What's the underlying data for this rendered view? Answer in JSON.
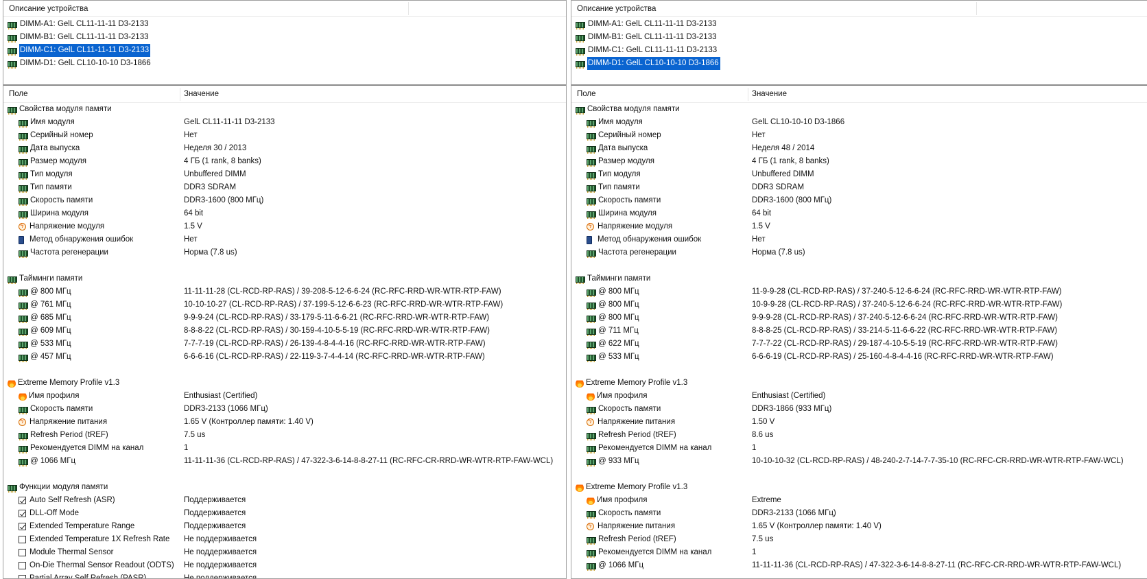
{
  "left": {
    "device_header": "Описание устройства",
    "devices": [
      {
        "label": "DIMM-A1: GelL CL11-11-11 D3-2133",
        "selected": false
      },
      {
        "label": "DIMM-B1: GelL CL11-11-11 D3-2133",
        "selected": false
      },
      {
        "label": "DIMM-C1: GelL CL11-11-11 D3-2133",
        "selected": true
      },
      {
        "label": "DIMM-D1: GelL CL10-10-10 D3-1866",
        "selected": false
      }
    ],
    "columns": {
      "field": "Поле",
      "value": "Значение"
    },
    "rows": [
      {
        "type": "section",
        "icon": "ram-icon",
        "label": "Свойства модуля памяти"
      },
      {
        "type": "item",
        "icon": "ram-icon",
        "label": "Имя модуля",
        "value": "GelL CL11-11-11 D3-2133"
      },
      {
        "type": "item",
        "icon": "ram-icon",
        "label": "Серийный номер",
        "value": "Нет"
      },
      {
        "type": "item",
        "icon": "ram-icon",
        "label": "Дата выпуска",
        "value": "Неделя 30 / 2013"
      },
      {
        "type": "item",
        "icon": "ram-icon",
        "label": "Размер модуля",
        "value": "4 ГБ (1 rank, 8 banks)"
      },
      {
        "type": "item",
        "icon": "ram-icon",
        "label": "Тип модуля",
        "value": "Unbuffered DIMM"
      },
      {
        "type": "item",
        "icon": "ram-icon",
        "label": "Тип памяти",
        "value": "DDR3 SDRAM"
      },
      {
        "type": "item",
        "icon": "ram-icon",
        "label": "Скорость памяти",
        "value": "DDR3-1600 (800 МГц)"
      },
      {
        "type": "item",
        "icon": "ram-icon",
        "label": "Ширина модуля",
        "value": "64 bit"
      },
      {
        "type": "item",
        "icon": "voltage-icon",
        "label": "Напряжение модуля",
        "value": "1.5 V"
      },
      {
        "type": "item",
        "icon": "error-detection-icon",
        "label": "Метод обнаружения ошибок",
        "value": "Нет"
      },
      {
        "type": "item",
        "icon": "ram-icon",
        "label": "Частота регенерации",
        "value": "Норма (7.8 us)"
      },
      {
        "type": "blank"
      },
      {
        "type": "section",
        "icon": "ram-icon",
        "label": "Тайминги памяти"
      },
      {
        "type": "item",
        "icon": "ram-icon",
        "label": "@ 800 МГц",
        "value": "11-11-11-28  (CL-RCD-RP-RAS) / 39-208-5-12-6-6-24  (RC-RFC-RRD-WR-WTR-RTP-FAW)"
      },
      {
        "type": "item",
        "icon": "ram-icon",
        "label": "@ 761 МГц",
        "value": "10-10-10-27  (CL-RCD-RP-RAS) / 37-199-5-12-6-6-23  (RC-RFC-RRD-WR-WTR-RTP-FAW)"
      },
      {
        "type": "item",
        "icon": "ram-icon",
        "label": "@ 685 МГц",
        "value": "9-9-9-24  (CL-RCD-RP-RAS) / 33-179-5-11-6-6-21  (RC-RFC-RRD-WR-WTR-RTP-FAW)"
      },
      {
        "type": "item",
        "icon": "ram-icon",
        "label": "@ 609 МГц",
        "value": "8-8-8-22  (CL-RCD-RP-RAS) / 30-159-4-10-5-5-19  (RC-RFC-RRD-WR-WTR-RTP-FAW)"
      },
      {
        "type": "item",
        "icon": "ram-icon",
        "label": "@ 533 МГц",
        "value": "7-7-7-19  (CL-RCD-RP-RAS) / 26-139-4-8-4-4-16  (RC-RFC-RRD-WR-WTR-RTP-FAW)"
      },
      {
        "type": "item",
        "icon": "ram-icon",
        "label": "@ 457 МГц",
        "value": "6-6-6-16  (CL-RCD-RP-RAS) / 22-119-3-7-4-4-14  (RC-RFC-RRD-WR-WTR-RTP-FAW)"
      },
      {
        "type": "blank"
      },
      {
        "type": "section",
        "icon": "fire-icon",
        "label": "Extreme Memory Profile v1.3"
      },
      {
        "type": "item",
        "icon": "fire-icon",
        "label": "Имя профиля",
        "value": "Enthusiast (Certified)"
      },
      {
        "type": "item",
        "icon": "ram-icon",
        "label": "Скорость памяти",
        "value": "DDR3-2133 (1066 МГц)"
      },
      {
        "type": "item",
        "icon": "voltage-icon",
        "label": "Напряжение питания",
        "value": "1.65 V  (Контроллер памяти: 1.40 V)"
      },
      {
        "type": "item",
        "icon": "ram-icon",
        "label": "Refresh Period (tREF)",
        "value": "7.5 us"
      },
      {
        "type": "item",
        "icon": "ram-icon",
        "label": "Рекомендуется DIMM на канал",
        "value": "1"
      },
      {
        "type": "item",
        "icon": "ram-icon",
        "label": "@ 1066 МГц",
        "value": "11-11-11-36  (CL-RCD-RP-RAS) / 47-322-3-6-14-8-8-27-11  (RC-RFC-CR-RRD-WR-WTR-RTP-FAW-WCL)"
      },
      {
        "type": "blank"
      },
      {
        "type": "section",
        "icon": "ram-icon",
        "label": "Функции модуля памяти"
      },
      {
        "type": "item",
        "icon": "checkbox-checked",
        "label": "Auto Self Refresh (ASR)",
        "value": "Поддерживается"
      },
      {
        "type": "item",
        "icon": "checkbox-checked",
        "label": "DLL-Off Mode",
        "value": "Поддерживается"
      },
      {
        "type": "item",
        "icon": "checkbox-checked",
        "label": "Extended Temperature Range",
        "value": "Поддерживается"
      },
      {
        "type": "item",
        "icon": "checkbox-unchecked",
        "label": "Extended Temperature 1X Refresh Rate",
        "value": "Не поддерживается"
      },
      {
        "type": "item",
        "icon": "checkbox-unchecked",
        "label": "Module Thermal Sensor",
        "value": "Не поддерживается"
      },
      {
        "type": "item",
        "icon": "checkbox-unchecked",
        "label": "On-Die Thermal Sensor Readout (ODTS)",
        "value": "Не поддерживается"
      },
      {
        "type": "item",
        "icon": "checkbox-unchecked",
        "label": "Partial Array Self Refresh (PASR)",
        "value": "Не поддерживается"
      }
    ]
  },
  "right": {
    "device_header": "Описание устройства",
    "devices": [
      {
        "label": "DIMM-A1: GelL CL11-11-11 D3-2133",
        "selected": false
      },
      {
        "label": "DIMM-B1: GelL CL11-11-11 D3-2133",
        "selected": false
      },
      {
        "label": "DIMM-C1: GelL CL11-11-11 D3-2133",
        "selected": false
      },
      {
        "label": "DIMM-D1: GelL CL10-10-10 D3-1866",
        "selected": true
      }
    ],
    "columns": {
      "field": "Поле",
      "value": "Значение"
    },
    "rows": [
      {
        "type": "section",
        "icon": "ram-icon",
        "label": "Свойства модуля памяти"
      },
      {
        "type": "item",
        "icon": "ram-icon",
        "label": "Имя модуля",
        "value": "GelL CL10-10-10 D3-1866"
      },
      {
        "type": "item",
        "icon": "ram-icon",
        "label": "Серийный номер",
        "value": "Нет"
      },
      {
        "type": "item",
        "icon": "ram-icon",
        "label": "Дата выпуска",
        "value": "Неделя 48 / 2014"
      },
      {
        "type": "item",
        "icon": "ram-icon",
        "label": "Размер модуля",
        "value": "4 ГБ (1 rank, 8 banks)"
      },
      {
        "type": "item",
        "icon": "ram-icon",
        "label": "Тип модуля",
        "value": "Unbuffered DIMM"
      },
      {
        "type": "item",
        "icon": "ram-icon",
        "label": "Тип памяти",
        "value": "DDR3 SDRAM"
      },
      {
        "type": "item",
        "icon": "ram-icon",
        "label": "Скорость памяти",
        "value": "DDR3-1600 (800 МГц)"
      },
      {
        "type": "item",
        "icon": "ram-icon",
        "label": "Ширина модуля",
        "value": "64 bit"
      },
      {
        "type": "item",
        "icon": "voltage-icon",
        "label": "Напряжение модуля",
        "value": "1.5 V"
      },
      {
        "type": "item",
        "icon": "error-detection-icon",
        "label": "Метод обнаружения ошибок",
        "value": "Нет"
      },
      {
        "type": "item",
        "icon": "ram-icon",
        "label": "Частота регенерации",
        "value": "Норма (7.8 us)"
      },
      {
        "type": "blank"
      },
      {
        "type": "section",
        "icon": "ram-icon",
        "label": "Тайминги памяти"
      },
      {
        "type": "item",
        "icon": "ram-icon",
        "label": "@ 800 МГц",
        "value": "11-9-9-28  (CL-RCD-RP-RAS) / 37-240-5-12-6-6-24  (RC-RFC-RRD-WR-WTR-RTP-FAW)"
      },
      {
        "type": "item",
        "icon": "ram-icon",
        "label": "@ 800 МГц",
        "value": "10-9-9-28  (CL-RCD-RP-RAS) / 37-240-5-12-6-6-24  (RC-RFC-RRD-WR-WTR-RTP-FAW)"
      },
      {
        "type": "item",
        "icon": "ram-icon",
        "label": "@ 800 МГц",
        "value": "9-9-9-28  (CL-RCD-RP-RAS) / 37-240-5-12-6-6-24  (RC-RFC-RRD-WR-WTR-RTP-FAW)"
      },
      {
        "type": "item",
        "icon": "ram-icon",
        "label": "@ 711 МГц",
        "value": "8-8-8-25  (CL-RCD-RP-RAS) / 33-214-5-11-6-6-22  (RC-RFC-RRD-WR-WTR-RTP-FAW)"
      },
      {
        "type": "item",
        "icon": "ram-icon",
        "label": "@ 622 МГц",
        "value": "7-7-7-22  (CL-RCD-RP-RAS) / 29-187-4-10-5-5-19  (RC-RFC-RRD-WR-WTR-RTP-FAW)"
      },
      {
        "type": "item",
        "icon": "ram-icon",
        "label": "@ 533 МГц",
        "value": "6-6-6-19  (CL-RCD-RP-RAS) / 25-160-4-8-4-4-16  (RC-RFC-RRD-WR-WTR-RTP-FAW)"
      },
      {
        "type": "blank"
      },
      {
        "type": "section",
        "icon": "fire-icon",
        "label": "Extreme Memory Profile v1.3"
      },
      {
        "type": "item",
        "icon": "fire-icon",
        "label": "Имя профиля",
        "value": "Enthusiast (Certified)"
      },
      {
        "type": "item",
        "icon": "ram-icon",
        "label": "Скорость памяти",
        "value": "DDR3-1866 (933 МГц)"
      },
      {
        "type": "item",
        "icon": "voltage-icon",
        "label": "Напряжение питания",
        "value": "1.50 V"
      },
      {
        "type": "item",
        "icon": "ram-icon",
        "label": "Refresh Period (tREF)",
        "value": "8.6 us"
      },
      {
        "type": "item",
        "icon": "ram-icon",
        "label": "Рекомендуется DIMM на канал",
        "value": "1"
      },
      {
        "type": "item",
        "icon": "ram-icon",
        "label": "@ 933 МГц",
        "value": "10-10-10-32  (CL-RCD-RP-RAS) / 48-240-2-7-14-7-7-35-10  (RC-RFC-CR-RRD-WR-WTR-RTP-FAW-WCL)"
      },
      {
        "type": "blank"
      },
      {
        "type": "section",
        "icon": "fire-icon",
        "label": "Extreme Memory Profile v1.3"
      },
      {
        "type": "item",
        "icon": "fire-icon",
        "label": "Имя профиля",
        "value": "Extreme"
      },
      {
        "type": "item",
        "icon": "ram-icon",
        "label": "Скорость памяти",
        "value": "DDR3-2133 (1066 МГц)"
      },
      {
        "type": "item",
        "icon": "voltage-icon",
        "label": "Напряжение питания",
        "value": "1.65 V  (Контроллер памяти: 1.40 V)"
      },
      {
        "type": "item",
        "icon": "ram-icon",
        "label": "Refresh Period (tREF)",
        "value": "7.5 us"
      },
      {
        "type": "item",
        "icon": "ram-icon",
        "label": "Рекомендуется DIMM на канал",
        "value": "1"
      },
      {
        "type": "item",
        "icon": "ram-icon",
        "label": "@ 1066 МГц",
        "value": "11-11-11-36  (CL-RCD-RP-RAS) / 47-322-3-6-14-8-8-27-11  (RC-RFC-CR-RRD-WR-WTR-RTP-FAW-WCL)"
      }
    ]
  },
  "colors": {
    "selection": "#0a64d0",
    "selection_text": "#ffffff",
    "border": "#9e9e9e"
  }
}
